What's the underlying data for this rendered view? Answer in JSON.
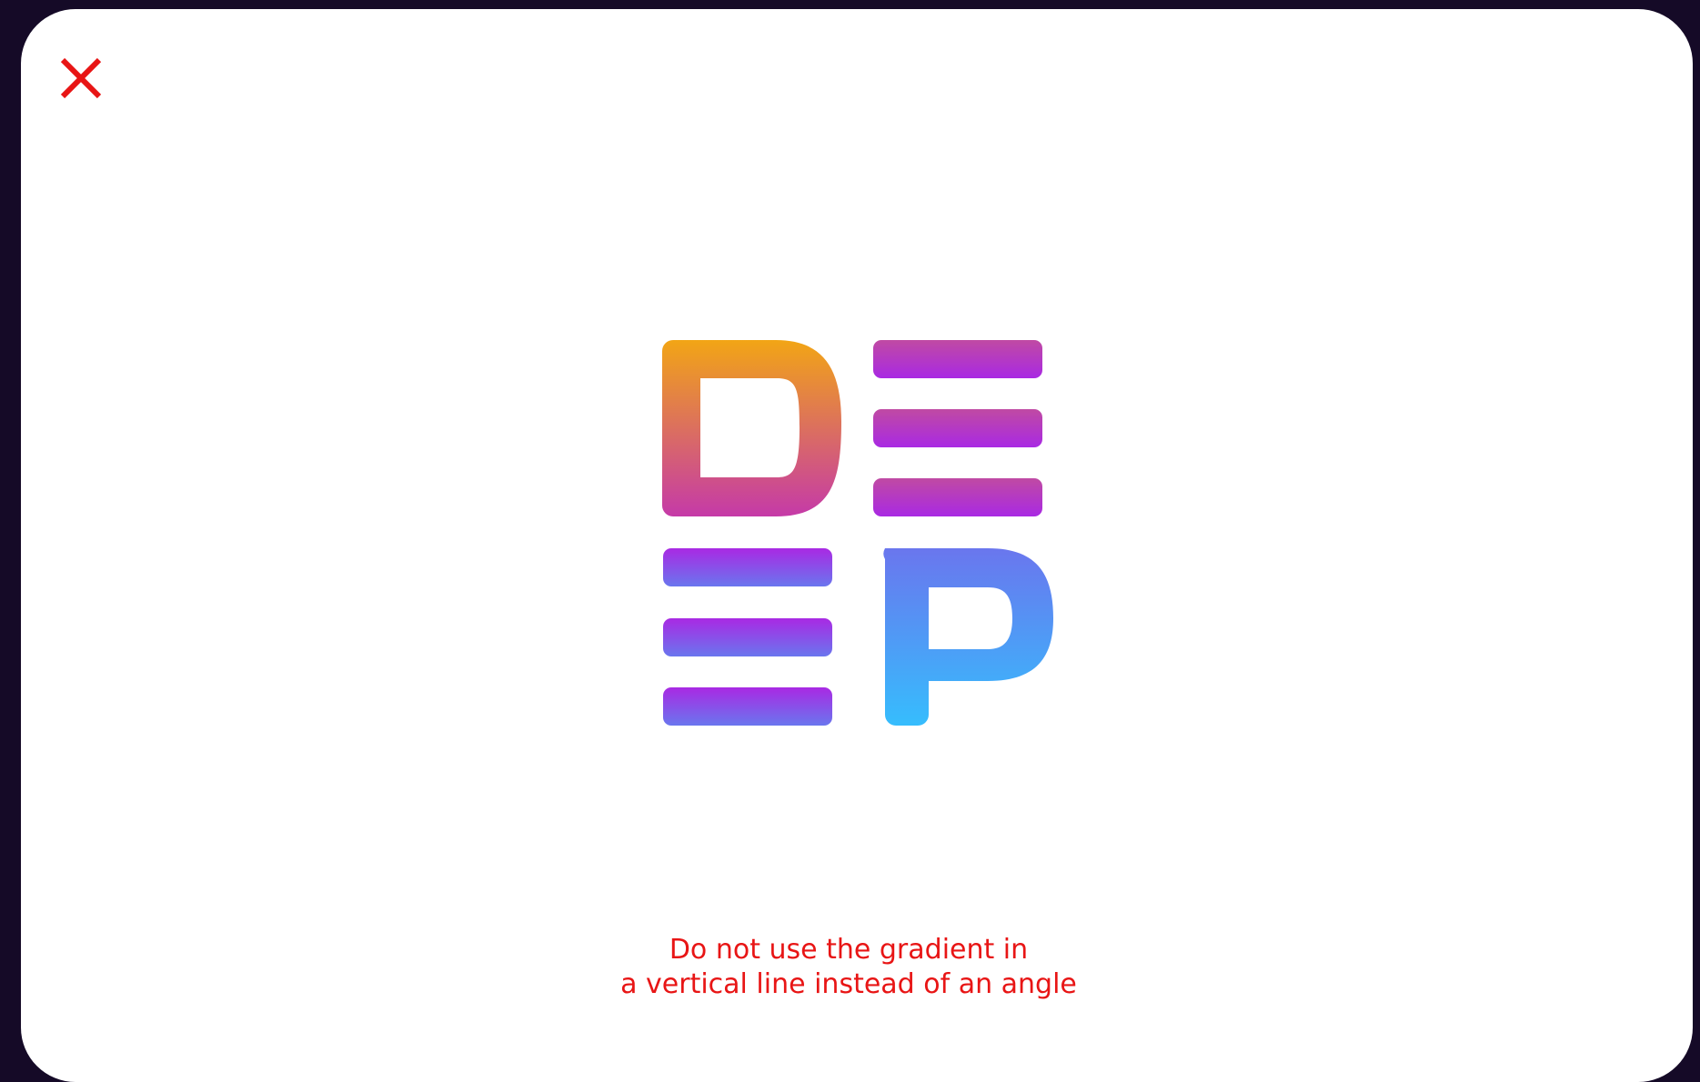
{
  "colors": {
    "background": "#150a27",
    "card": "#ffffff",
    "warning_red": "#e81515",
    "gradient_orange": "#f2a515",
    "gradient_magenta": "#c53aa8",
    "gradient_purple": "#a929e3",
    "gradient_indigo": "#6a76ee",
    "gradient_cyan": "#36bdfd"
  },
  "icons": {
    "close": "close-icon"
  },
  "logo": {
    "letters": [
      "D",
      "E",
      "E",
      "P"
    ],
    "style": "vertical gradient (incorrect usage example)"
  },
  "caption": {
    "line1": "Do not use the gradient in",
    "line2": "a vertical line instead of an angle"
  }
}
